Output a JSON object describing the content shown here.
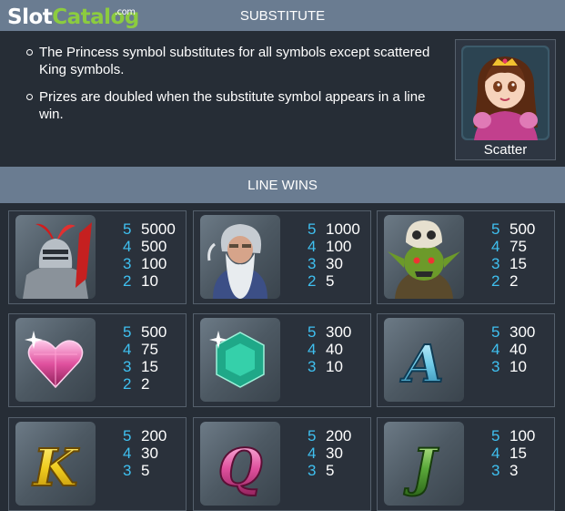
{
  "logo": {
    "part1": "Slot",
    "part2": "Catalog",
    "suffix": ".com"
  },
  "substitute": {
    "title": "SUBSTITUTE",
    "bullets": [
      "The Princess symbol substitutes for all symbols except scattered King symbols.",
      "Prizes are doubled when the substitute symbol appears in a line win."
    ],
    "card_label": "Scatter"
  },
  "line_wins": {
    "title": "LINE WINS",
    "symbols": [
      {
        "icon": "knight-icon",
        "pays": [
          {
            "n": "5",
            "v": "5000"
          },
          {
            "n": "4",
            "v": "500"
          },
          {
            "n": "3",
            "v": "100"
          },
          {
            "n": "2",
            "v": "10"
          }
        ]
      },
      {
        "icon": "wizard-icon",
        "pays": [
          {
            "n": "5",
            "v": "1000"
          },
          {
            "n": "4",
            "v": "100"
          },
          {
            "n": "3",
            "v": "30"
          },
          {
            "n": "2",
            "v": "5"
          }
        ]
      },
      {
        "icon": "goblin-icon",
        "pays": [
          {
            "n": "5",
            "v": "500"
          },
          {
            "n": "4",
            "v": "75"
          },
          {
            "n": "3",
            "v": "15"
          },
          {
            "n": "2",
            "v": "2"
          }
        ]
      },
      {
        "icon": "heart-gem-icon",
        "pays": [
          {
            "n": "5",
            "v": "500"
          },
          {
            "n": "4",
            "v": "75"
          },
          {
            "n": "3",
            "v": "15"
          },
          {
            "n": "2",
            "v": "2"
          }
        ]
      },
      {
        "icon": "emerald-gem-icon",
        "pays": [
          {
            "n": "5",
            "v": "300"
          },
          {
            "n": "4",
            "v": "40"
          },
          {
            "n": "3",
            "v": "10"
          }
        ]
      },
      {
        "icon": "letter-a-icon",
        "pays": [
          {
            "n": "5",
            "v": "300"
          },
          {
            "n": "4",
            "v": "40"
          },
          {
            "n": "3",
            "v": "10"
          }
        ]
      },
      {
        "icon": "letter-k-icon",
        "pays": [
          {
            "n": "5",
            "v": "200"
          },
          {
            "n": "4",
            "v": "30"
          },
          {
            "n": "3",
            "v": "5"
          }
        ]
      },
      {
        "icon": "letter-q-icon",
        "pays": [
          {
            "n": "5",
            "v": "200"
          },
          {
            "n": "4",
            "v": "30"
          },
          {
            "n": "3",
            "v": "5"
          }
        ]
      },
      {
        "icon": "letter-j-icon",
        "pays": [
          {
            "n": "5",
            "v": "100"
          },
          {
            "n": "4",
            "v": "15"
          },
          {
            "n": "3",
            "v": "3"
          }
        ]
      }
    ]
  },
  "colors": {
    "header_bar": "#6a7c91",
    "background": "#262d36",
    "count_blue": "#3fc0f0",
    "logo_green": "#8ccc3f"
  }
}
